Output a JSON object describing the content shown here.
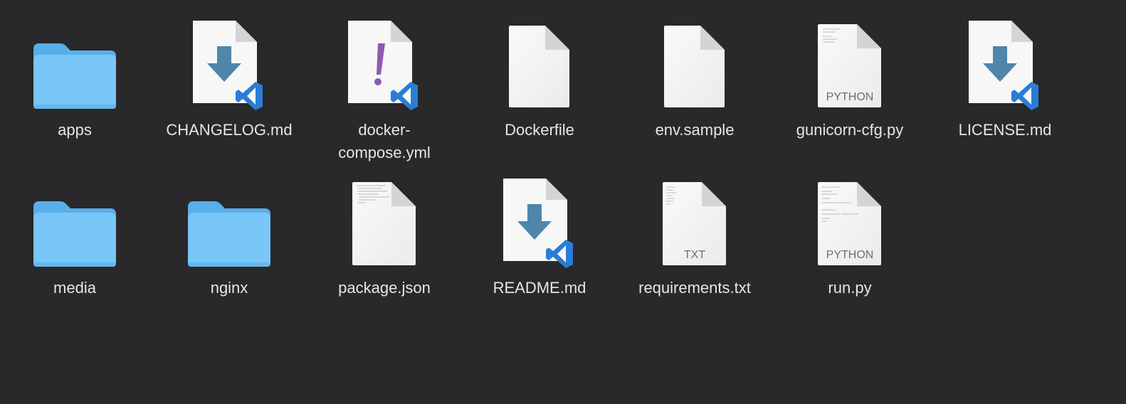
{
  "window": {
    "background": "#29282a"
  },
  "colors": {
    "folder_back": "#5aaee8",
    "folder_front": "#79c6f8",
    "doc_fill": "#f4f4f4",
    "doc_fold": "#d4d4d4",
    "download_arrow": "#4f86aa",
    "vscode_blue": "#2a7dd6",
    "yaml_purple": "#8d5bb2",
    "label_text": "#e6e6e6"
  },
  "files": [
    {
      "name": "apps",
      "icon": "folder-icon"
    },
    {
      "name": "CHANGELOG.md",
      "icon": "markdown-vscode-icon"
    },
    {
      "name": "docker-\ncompose.yml",
      "icon": "yaml-vscode-icon"
    },
    {
      "name": "Dockerfile",
      "icon": "blank-document-icon"
    },
    {
      "name": "env.sample",
      "icon": "blank-document-icon"
    },
    {
      "name": "gunicorn-cfg.py",
      "icon": "python-document-icon",
      "badge": "PYTHON"
    },
    {
      "name": "LICENSE.md",
      "icon": "markdown-vscode-icon"
    },
    {
      "name": "media",
      "icon": "folder-icon"
    },
    {
      "name": "nginx",
      "icon": "folder-icon"
    },
    {
      "name": "package.json",
      "icon": "json-document-icon"
    },
    {
      "name": "README.md",
      "icon": "markdown-vscode-icon"
    },
    {
      "name": "requirements.txt",
      "icon": "text-document-icon",
      "badge": "TXT"
    },
    {
      "name": "run.py",
      "icon": "python-document-icon",
      "badge": "PYTHON"
    }
  ]
}
